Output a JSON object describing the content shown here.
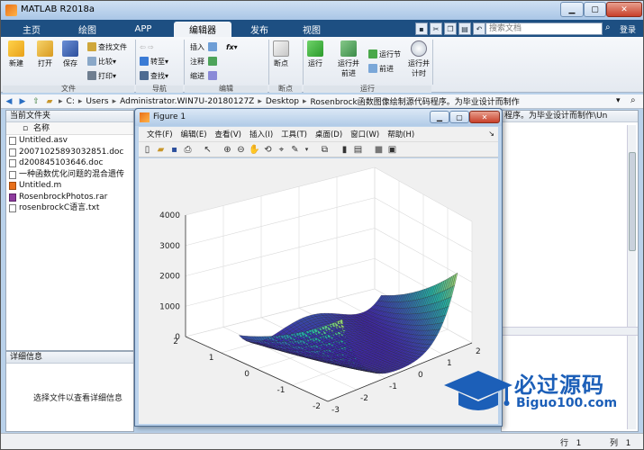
{
  "window": {
    "title": "MATLAB R2018a",
    "close_label": "✕"
  },
  "tabs": [
    {
      "label": "主页"
    },
    {
      "label": "绘图"
    },
    {
      "label": "APP"
    },
    {
      "label": "编辑器"
    },
    {
      "label": "发布"
    },
    {
      "label": "视图"
    }
  ],
  "search": {
    "placeholder": "搜索文档",
    "collapse_label": "登录"
  },
  "ribbon": {
    "file_group": {
      "label": "文件",
      "new": "新建",
      "open": "打开",
      "save": "保存",
      "find_files": "查找文件",
      "compare": "比较",
      "print": "打印"
    },
    "nav_group": {
      "label": "导航",
      "goto": "转至",
      "find": "查找"
    },
    "edit_group": {
      "label": "编辑",
      "insert": "插入",
      "comment": "注释",
      "indent": "缩进",
      "fx": "fx"
    },
    "bp_group": {
      "label": "断点",
      "breakpoints": "断点"
    },
    "run_group": {
      "label": "运行",
      "run": "运行",
      "run_advance": "运行并\n前进",
      "run_section": "运行节",
      "advance": "前进",
      "run_time": "运行并\n计时"
    }
  },
  "address": {
    "crumbs": [
      "C:",
      "Users",
      "Administrator.WIN7U-20180127Z",
      "Desktop",
      "Rosenbrock函数图像绘制源代码程序。为毕业设计而制作"
    ]
  },
  "current_folder": {
    "title": "当前文件夹",
    "col_name": "名称",
    "files": [
      {
        "name": "Untitled.asv",
        "type": "doc"
      },
      {
        "name": "20071025893032851.doc",
        "type": "doc"
      },
      {
        "name": "d200845103646.doc",
        "type": "doc"
      },
      {
        "name": "一种函数优化问题的混合遗传",
        "type": "doc"
      },
      {
        "name": "Untitled.m",
        "type": "m"
      },
      {
        "name": "RosenbrockPhotos.rar",
        "type": "rar"
      },
      {
        "name": "rosenbrockC语言.txt",
        "type": "doc"
      }
    ]
  },
  "details": {
    "title": "详细信息",
    "message": "选择文件以查看详细信息"
  },
  "right_panel": {
    "header": "程序。为毕业设计而制作\\Un"
  },
  "status": {
    "row_label": "行",
    "row_value": "1",
    "col_label": "列",
    "col_value": "1"
  },
  "figure": {
    "title": "Figure 1",
    "menu": [
      "文件(F)",
      "编辑(E)",
      "查看(V)",
      "插入(I)",
      "工具(T)",
      "桌面(D)",
      "窗口(W)",
      "帮助(H)"
    ],
    "z_ticks": [
      "0",
      "1000",
      "2000",
      "3000",
      "4000"
    ],
    "y_ticks": [
      "2",
      "1",
      "0",
      "-1",
      "-2"
    ],
    "x_ticks": [
      "-3",
      "-2",
      "-1",
      "0",
      "1",
      "2"
    ],
    "colors": {
      "low": "#3e26a8",
      "mid": "#25b4a7",
      "high": "#f9e84a"
    }
  },
  "watermark": {
    "cn": "必过源码",
    "en": "Biguo100.com"
  }
}
